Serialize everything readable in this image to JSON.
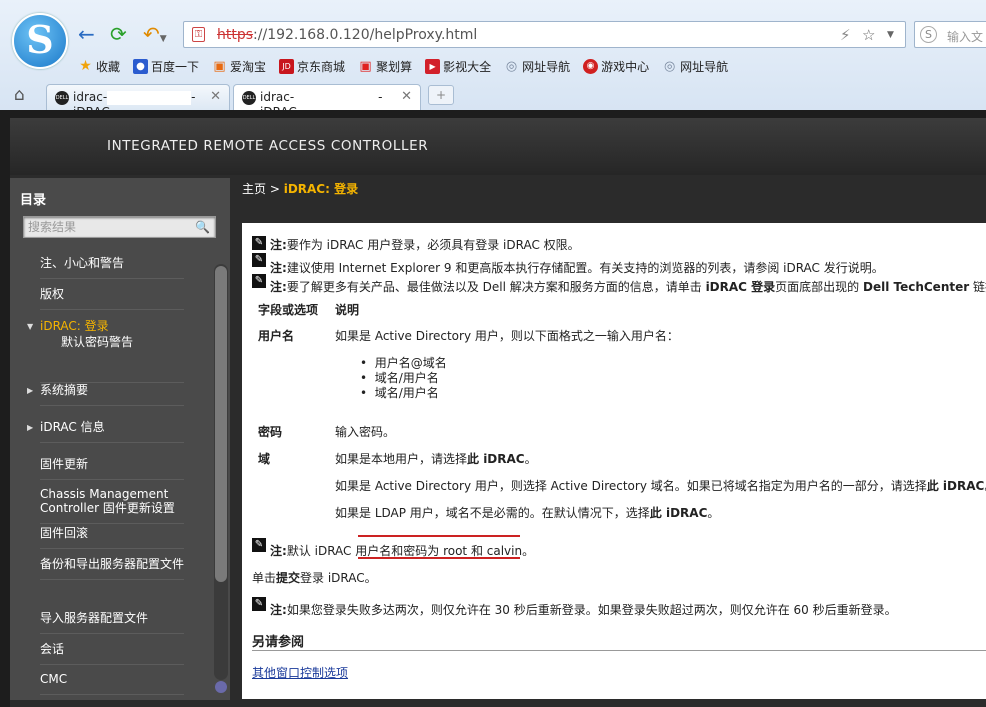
{
  "browser": {
    "logo_letter": "S",
    "url_scheme": "https",
    "url_rest": "://192.168.0.120/helpProxy.html",
    "search_placeholder": "输入文",
    "bookmarks": [
      {
        "label": "收藏",
        "icon": "star-icon",
        "color": "#f0a30a"
      },
      {
        "label": "百度一下",
        "icon": "paw-icon",
        "color": "#2b5ccf"
      },
      {
        "label": "爱淘宝",
        "icon": "doc-icon",
        "color": "#e86a10"
      },
      {
        "label": "京东商城",
        "icon": "jd-icon",
        "color": "#c8161d"
      },
      {
        "label": "聚划算",
        "icon": "doc-icon",
        "color": "#e02020"
      },
      {
        "label": "影视大全",
        "icon": "play-icon",
        "color": "#d2202a"
      },
      {
        "label": "网址导航",
        "icon": "globe-icon",
        "color": "#7a8aa0"
      },
      {
        "label": "游戏中心",
        "icon": "game-icon",
        "color": "#d02020"
      },
      {
        "label": "网址导航",
        "icon": "globe-icon",
        "color": "#7a8aa0"
      }
    ],
    "tabs": [
      {
        "prefix": "idrac-",
        "suffix": "- iDRAC"
      },
      {
        "prefix": "idrac-",
        "suffix": "- iDRAC"
      }
    ],
    "new_tab_label": "+"
  },
  "banner": {
    "title": "INTEGRATED REMOTE ACCESS CONTROLLER"
  },
  "sidebar": {
    "title": "目录",
    "search_placeholder": "搜索结果",
    "items": [
      {
        "label": "注、小心和警告"
      },
      {
        "label": "版权"
      },
      {
        "label": "iDRAC: 登录",
        "sub": "默认密码警告"
      },
      {
        "label": "系统摘要"
      },
      {
        "label": "iDRAC 信息"
      },
      {
        "label": "固件更新"
      },
      {
        "label": "Chassis Management Controller 固件更新设置"
      },
      {
        "label": "固件回滚"
      },
      {
        "label": "备份和导出服务器配置文件"
      },
      {
        "label": "导入服务器配置文件"
      },
      {
        "label": "会话"
      },
      {
        "label": "CMC"
      }
    ]
  },
  "breadcrumb": {
    "home": "主页",
    "sep": " > ",
    "current": "iDRAC: 登录"
  },
  "content": {
    "note_label": "注:",
    "note0": "要作为 iDRAC 用户登录，必须具有登录 iDRAC 权限。",
    "note1": "建议使用 Internet Explorer 9 和更高版本执行存储配置。有关支持的浏览器的列表，请参阅 iDRAC 发行说明。",
    "note2_a": "要了解更多有关产品、最佳做法以及 Dell 解决方案和服务方面的信息，请单击 ",
    "note2_b": "iDRAC 登录",
    "note2_c": "页面底部出现的 ",
    "note2_d": "Dell TechCenter",
    "note2_e": " 链接。",
    "th_field": "字段或选项",
    "th_desc": "说明",
    "r1_field": "用户名",
    "r1_desc": "如果是 Active Directory 用户，则以下面格式之一输入用户名：",
    "r1_list": [
      "用户名@域名",
      "域名/用户名",
      "域名/用户名"
    ],
    "r2_field": "密码",
    "r2_desc": "输入密码。",
    "r3_field": "域",
    "r3_a1": "如果是本地用户，请选择",
    "r3_a2": "此 iDRAC",
    "r3_a3": "。",
    "r3_b1": "如果是 Active Directory 用户，则选择 Active Directory 域名。如果已将域名指定为用户名的一部分，请选择",
    "r3_b2": "此 iDRAC",
    "r3_b3": "。",
    "r3_c1": "如果是 LDAP 用户，域名不是必需的。在默认情况下，选择",
    "r3_c2": "此 iDRAC",
    "r3_c3": "。",
    "note3_a": "默认 iDRAC ",
    "note3_b": "用户名和密码为 root 和 calvin",
    "note3_c": "。",
    "submit_a": "单击",
    "submit_b": "提交",
    "submit_c": "登录 iDRAC。",
    "note4": "如果您登录失败多达两次，则仅允许在 30 秒后重新登录。如果登录失败超过两次，则仅允许在 60 秒后重新登录。",
    "see_also": "另请参阅",
    "see_link": "其他窗口控制选项"
  }
}
